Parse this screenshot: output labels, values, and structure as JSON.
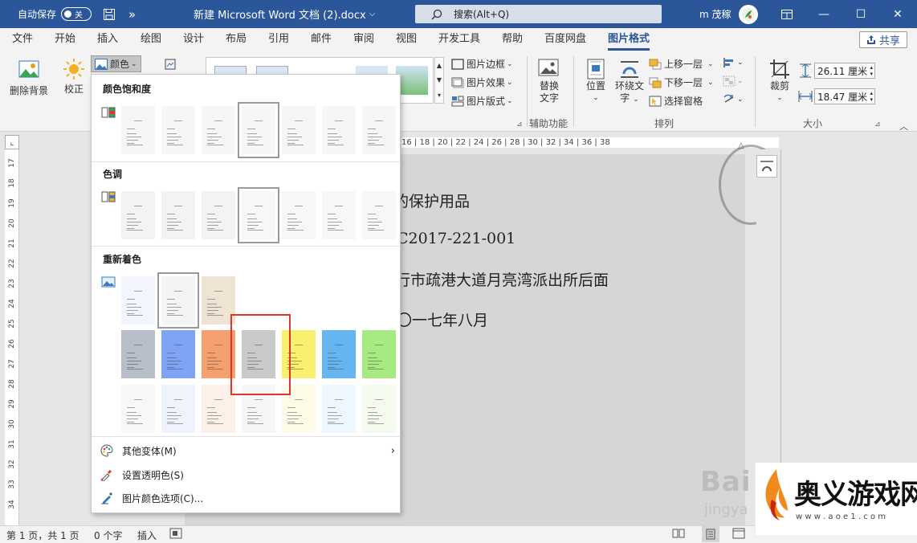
{
  "titlebar": {
    "autosave_label": "自动保存",
    "autosave_state": "关",
    "more_symbol": "»",
    "doc_title": "新建 Microsoft Word 文档 (2).docx",
    "search_placeholder": "搜索(Alt+Q)",
    "user_name": "m 茂稼",
    "minimize": "—",
    "maximize": "☐",
    "close": "✕",
    "bg_color": "#2b579a"
  },
  "tabs": [
    "文件",
    "开始",
    "插入",
    "绘图",
    "设计",
    "布局",
    "引用",
    "邮件",
    "审阅",
    "视图",
    "开发工具",
    "帮助",
    "百度网盘",
    "图片格式"
  ],
  "active_tab": "图片格式",
  "share_label": "共享",
  "ribbon": {
    "remove_bg": "删除背景",
    "correct": "校正",
    "color": "颜色",
    "border": "图片边框",
    "effects": "图片效果",
    "layout": "图片版式",
    "alt_text_line1": "替换",
    "alt_text_line2": "文字",
    "accessibility_group": "辅助功能",
    "position": "位置",
    "wrap_line1": "环绕文",
    "wrap_line2": "字",
    "bring_forward": "上移一层",
    "send_backward": "下移一层",
    "selection_pane": "选择窗格",
    "arrange_group": "排列",
    "crop": "裁剪",
    "height_value": "26.11 厘米",
    "width_value": "18.47 厘米",
    "size_group": "大小"
  },
  "ruler_h_text": "16 | 18 | 20 | 22 | 24 | 26 | 28 | 30 | 32 | 34 | 36 | 38",
  "ruler_v_numbers": [
    "17",
    "18",
    "19",
    "20",
    "21",
    "22",
    "23",
    "24",
    "25",
    "26",
    "27",
    "28",
    "29",
    "30",
    "31",
    "32",
    "33",
    "34"
  ],
  "document": {
    "line1": "的保护用品",
    "line2": "C2017-221-001",
    "line3": "行市疏港大道月亮湾派出所后面",
    "line4": "〇一七年八月"
  },
  "color_menu": {
    "saturation_title": "颜色饱和度",
    "tone_title": "色调",
    "recolor_title": "重新着色",
    "more_variations": "其他变体(M)",
    "set_transparent": "设置透明色(S)",
    "color_options": "图片颜色选项(C)...",
    "recolor_row1": [
      "#f2f5fb",
      "#f4f4f4",
      "#efe3d4"
    ],
    "recolor_row2": [
      "#b7bdc9",
      "#7fa4f5",
      "#f6a070",
      "#c9c9c9",
      "#f8f06e",
      "#64b5f0",
      "#a8ea82"
    ],
    "recolor_row3": [
      "#f8f8f8",
      "#eef3fc",
      "#fcf0e8",
      "#f6f6f6",
      "#fdfbe8",
      "#eef7fd",
      "#f2fbee"
    ],
    "highlight_color": "#e0352b"
  },
  "statusbar": {
    "page": "第 1 页，共 1 页",
    "words": "0 个字",
    "mode": "插入",
    "zoom_minus": "—"
  },
  "watermark": {
    "baidu": "Bai",
    "jingyan": "jingya",
    "site_name": "奥义游戏网",
    "site_url": "w w w . a o e 1 . c o m"
  }
}
